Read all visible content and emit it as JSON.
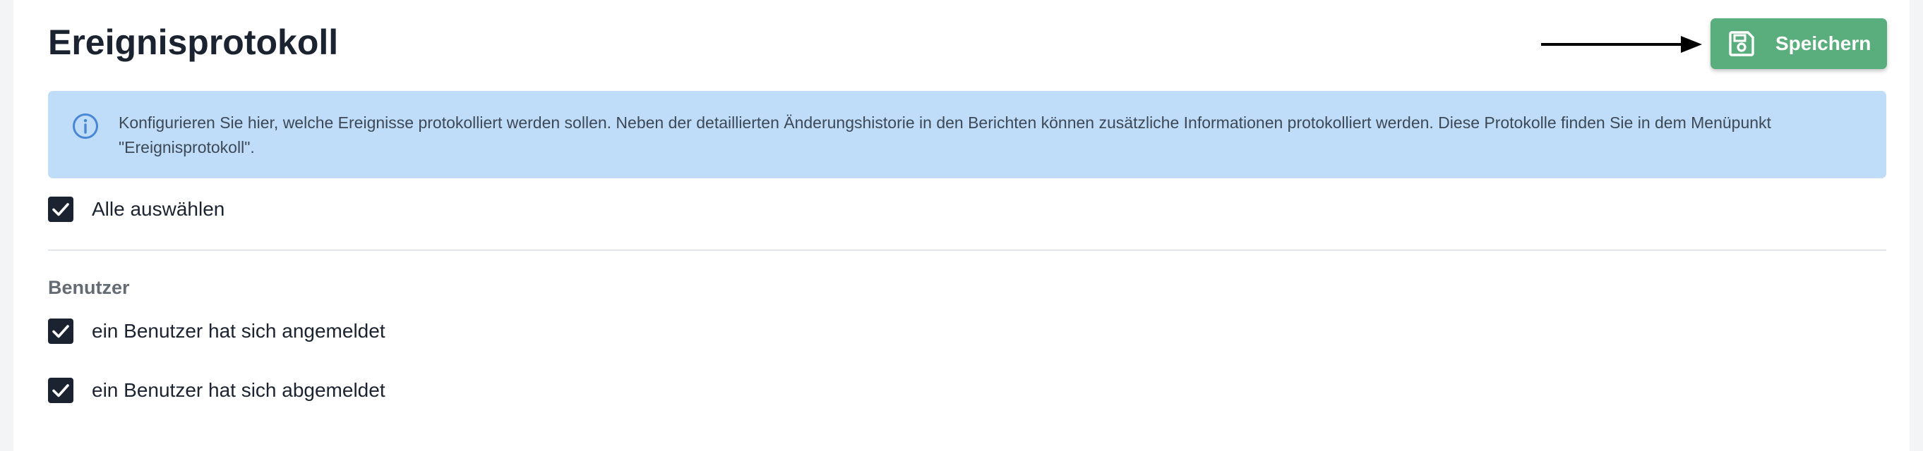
{
  "page": {
    "title": "Ereignisprotokoll"
  },
  "toolbar": {
    "save_label": "Speichern",
    "save_icon": "floppy-disk-icon",
    "pointer_arrow_icon": "arrow-right-icon"
  },
  "info": {
    "icon": "info-circle-icon",
    "text": "Konfigurieren Sie hier, welche Ereignisse protokolliert werden sollen. Neben der detaillierten Änderungshistorie in den Berichten können zusätzliche Informationen protokolliert werden. Diese Protokolle finden Sie in dem Menüpunkt \"Ereignisprotokoll\"."
  },
  "select_all": {
    "label": "Alle auswählen",
    "checked": true
  },
  "sections": [
    {
      "heading": "Benutzer",
      "items": [
        {
          "label": "ein Benutzer hat sich angemeldet",
          "checked": true
        },
        {
          "label": "ein Benutzer hat sich abgemeldet",
          "checked": true
        }
      ]
    }
  ],
  "colors": {
    "primary_text": "#1b2330",
    "save_button": "#5aad7c",
    "info_background": "#bfdcf8",
    "info_icon": "#4a86d6",
    "checkbox_fill": "#1b2330",
    "section_heading": "#646b73"
  }
}
